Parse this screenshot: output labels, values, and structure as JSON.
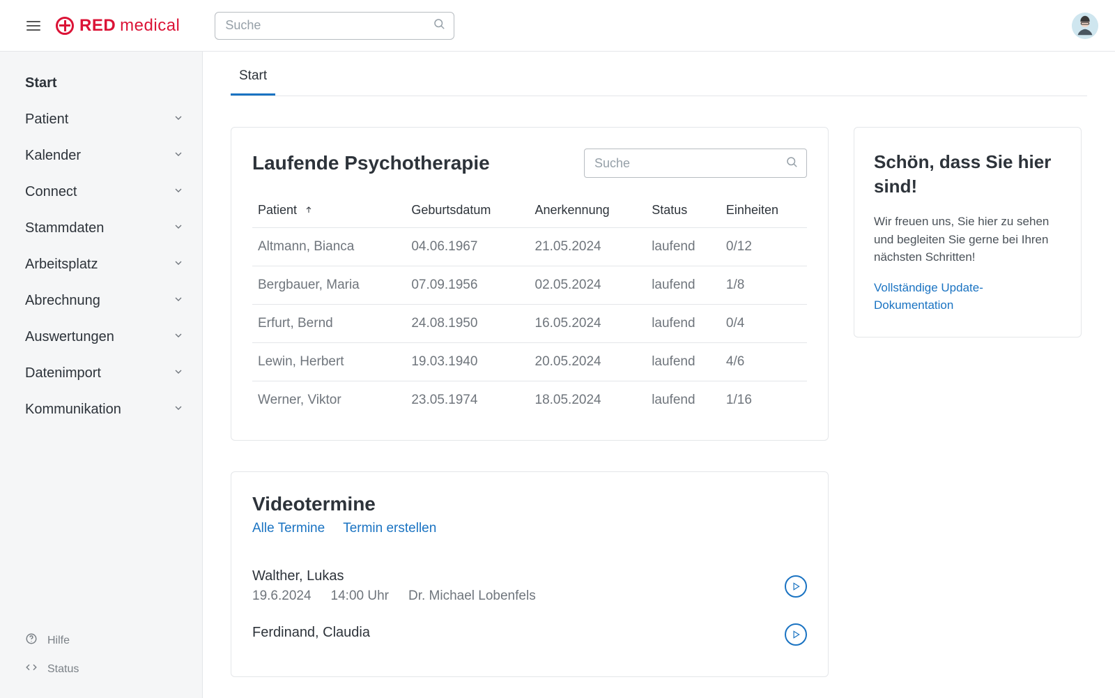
{
  "brand": {
    "red": "RED",
    "medical": "medical"
  },
  "search": {
    "placeholder": "Suche"
  },
  "sidebar": {
    "items": [
      {
        "label": "Start",
        "hasChildren": false,
        "active": true
      },
      {
        "label": "Patient",
        "hasChildren": true
      },
      {
        "label": "Kalender",
        "hasChildren": true
      },
      {
        "label": "Connect",
        "hasChildren": true
      },
      {
        "label": "Stammdaten",
        "hasChildren": true
      },
      {
        "label": "Arbeitsplatz",
        "hasChildren": true
      },
      {
        "label": "Abrechnung",
        "hasChildren": true
      },
      {
        "label": "Auswertungen",
        "hasChildren": true
      },
      {
        "label": "Datenimport",
        "hasChildren": true
      },
      {
        "label": "Kommunikation",
        "hasChildren": true
      }
    ],
    "footer": {
      "help": "Hilfe",
      "status": "Status"
    }
  },
  "tabs": {
    "start": "Start"
  },
  "therapy": {
    "title": "Laufende Psychotherapie",
    "searchPlaceholder": "Suche",
    "columns": {
      "patient": "Patient",
      "birth": "Geburtsdatum",
      "approval": "Anerkennung",
      "status": "Status",
      "units": "Einheiten"
    },
    "rows": [
      {
        "patient": "Altmann, Bianca",
        "birth": "04.06.1967",
        "approval": "21.05.2024",
        "status": "laufend",
        "units": "0/12"
      },
      {
        "patient": "Bergbauer, Maria",
        "birth": "07.09.1956",
        "approval": "02.05.2024",
        "status": "laufend",
        "units": "1/8"
      },
      {
        "patient": "Erfurt, Bernd",
        "birth": "24.08.1950",
        "approval": "16.05.2024",
        "status": "laufend",
        "units": "0/4"
      },
      {
        "patient": "Lewin, Herbert",
        "birth": "19.03.1940",
        "approval": "20.05.2024",
        "status": "laufend",
        "units": "4/6"
      },
      {
        "patient": "Werner, Viktor",
        "birth": "23.05.1974",
        "approval": "18.05.2024",
        "status": "laufend",
        "units": "1/16"
      }
    ]
  },
  "video": {
    "title": "Videotermine",
    "linkAll": "Alle Termine",
    "linkCreate": "Termin erstellen",
    "appts": [
      {
        "name": "Walther, Lukas",
        "date": "19.6.2024",
        "time": "14:00 Uhr",
        "doctor": "Dr. Michael Lobenfels"
      },
      {
        "name": "Ferdinand, Claudia",
        "date": "",
        "time": "",
        "doctor": ""
      }
    ]
  },
  "welcome": {
    "title": "Schön, dass Sie hier sind!",
    "body": "Wir freuen uns, Sie hier zu sehen und begleiten Sie gerne bei Ihren nächsten Schritten!",
    "link": "Vollständige Update-Dokumentation"
  }
}
